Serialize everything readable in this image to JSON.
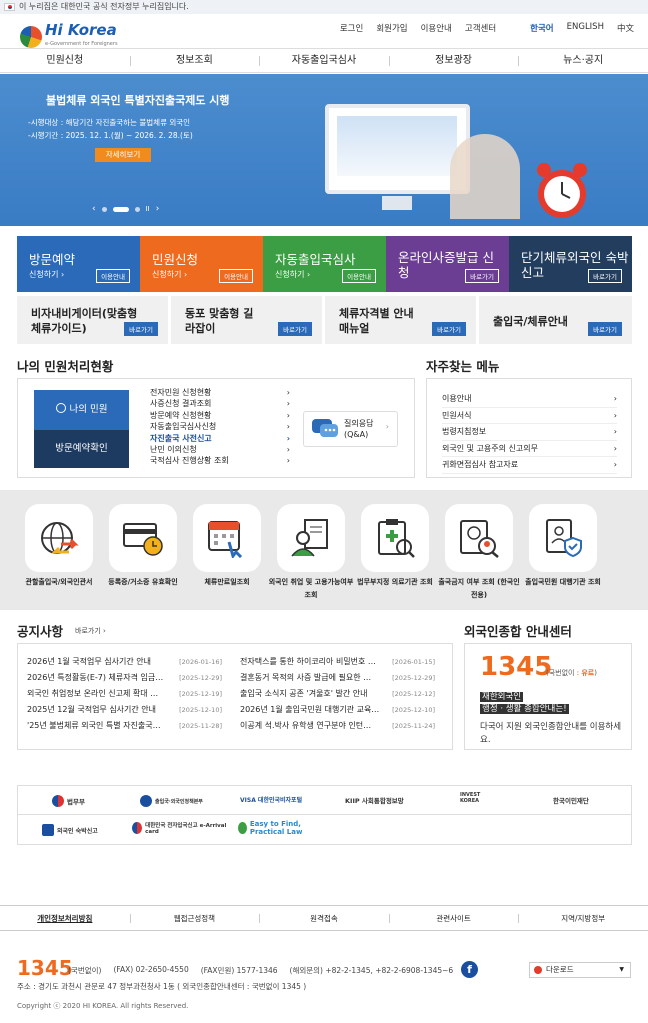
{
  "gov_bar": {
    "text": "이 누리집은 대한민국 공식 전자정부 누리집입니다."
  },
  "logo": {
    "name": "Hi Korea",
    "tagline": "e-Government for Foreigners"
  },
  "top_nav": [
    "로그인",
    "회원가입",
    "이용안내",
    "고객센터"
  ],
  "languages": [
    {
      "label": "한국어",
      "active": true
    },
    {
      "label": "ENGLISH",
      "active": false
    },
    {
      "label": "中文",
      "active": false
    }
  ],
  "main_menu": [
    "민원신청",
    "정보조회",
    "자동출입국심사",
    "정보광장",
    "뉴스·공지"
  ],
  "banner": {
    "title": "불법체류 외국인 특별자진출국제도 시행",
    "line1": "-시행대상 : 해당기간 자진출국하는 불법체류 외국인",
    "line2": "-시행기간 : 2025. 12. 1.(월) ~ 2026. 2. 28.(토)",
    "button": "자세히보기",
    "slide_controls": {
      "prev": "‹",
      "next": "›",
      "pause": "II"
    }
  },
  "service_tiles": [
    {
      "title": "방문예약",
      "sub": "신청하기 ›",
      "button": "이용안내",
      "color": "#2a6ab8"
    },
    {
      "title": "민원신청",
      "sub": "신청하기 ›",
      "button": "이용안내",
      "color": "#ee6a1f"
    },
    {
      "title": "자동출입국심사",
      "sub": "신청하기 ›",
      "button": "이용안내",
      "color": "#3b9d44"
    },
    {
      "title": "온라인사증발급 신청",
      "sub": "",
      "button": "바로가기",
      "color": "#6b3d93"
    },
    {
      "title": "단기체류외국인 숙박신고",
      "sub": "",
      "button": "바로가기",
      "color": "#223d5e"
    }
  ],
  "guide_tiles": [
    {
      "title": "비자내비게이터(맞춤형 체류가이드)",
      "button": "바로가기"
    },
    {
      "title": "동포 맞춤형 길라잡이",
      "button": "바로가기"
    },
    {
      "title": "체류자격별 안내매뉴얼",
      "button": "바로가기"
    },
    {
      "title": "출입국/체류안내",
      "button": "바로가기"
    }
  ],
  "my_status": {
    "heading": "나의 민원처리현황",
    "my_civil": "나의 민원",
    "visit_check": "방문예약확인",
    "items": [
      "전자민원 신청현황",
      "사증신청 결과조회",
      "방문예약 신청현황",
      "자동출입국심사신청",
      "자진출국 사전신고",
      "난민 이의신청",
      "국적심사 진행상황 조회"
    ],
    "highlight_index": 4,
    "qna": {
      "line1": "질의응답",
      "line2": "(Q&A)"
    }
  },
  "favorites": {
    "heading": "자주찾는 메뉴",
    "items": [
      "이용안내",
      "민원서식",
      "법령지침정보",
      "외국인 및 고용주의 신고의무",
      "귀화면접심사 참고자료"
    ]
  },
  "quick_icons": [
    {
      "label": "관할출입국/외국인관서",
      "icon": "globe-arrows-icon"
    },
    {
      "label": "등록증/거소증 유효확인",
      "icon": "id-card-clock-icon"
    },
    {
      "label": "체류만료일조회",
      "icon": "calendar-click-icon"
    },
    {
      "label": "외국인 취업 및 고용가능여부 조회",
      "icon": "worker-document-icon"
    },
    {
      "label": "법무부지정 의료기관 조회",
      "icon": "medical-clipboard-icon"
    },
    {
      "label": "출국금지 여부 조회 (한국인 전용)",
      "icon": "passport-search-icon"
    },
    {
      "label": "출입국민원 대행기관 조회",
      "icon": "agency-shield-icon"
    }
  ],
  "notices": {
    "heading": "공지사항",
    "more": "바로가기 ›",
    "left": [
      {
        "title": "2026년 1월 국적업무 심사기간 안내",
        "date": "[2026-01-16]"
      },
      {
        "title": "2026년 특정활동(E-7) 체류자격 임금…",
        "date": "[2025-12-29]"
      },
      {
        "title": "외국인 취업정보 온라인 신고제 확대 …",
        "date": "[2025-12-19]"
      },
      {
        "title": "2025년 12월 국적업무 심사기간 안내",
        "date": "[2025-12-10]"
      },
      {
        "title": "'25년 불법체류 외국인 특별 자진출국…",
        "date": "[2025-11-28]"
      }
    ],
    "right": [
      {
        "title": "전자택스를 통한 하이코리아 비밀번호 …",
        "date": "[2026-01-15]"
      },
      {
        "title": "결혼동거 목적의 사증 발급에 필요한 …",
        "date": "[2025-12-29]"
      },
      {
        "title": "출입국 소식지 공존 '겨울호' 발간 안내",
        "date": "[2025-12-12]"
      },
      {
        "title": "2026년 1월 출입국민원 대행기관 교육…",
        "date": "[2025-12-10]"
      },
      {
        "title": "이공계 석.박사 유학생 연구분야 인턴…",
        "date": "[2025-11-24]"
      }
    ]
  },
  "contact_center": {
    "heading": "외국인종합 안내센터",
    "number": "1345",
    "note_prefix": "(국번없이 : ",
    "note_paid": "유료",
    "note_suffix": ")",
    "hl1": "재한외국인",
    "hl2": "행정 · 생활 종합안내는!",
    "desc": "다국어 지원 외국인종합안내를 이용하세요."
  },
  "partners_row1": [
    "법무부",
    "출입국·외국인정책본부",
    "VISA 대한민국비자포털",
    "KIIP 사회통합정보망",
    "INVEST KOREA",
    "한국이민재단"
  ],
  "partners_row2": [
    "외국인 숙박신고",
    "대한민국 전자입국신고 e-Arrival card",
    "Easy to Find, Practical Law"
  ],
  "footer_nav": [
    "개인정보처리방침",
    "웹접근성정책",
    "원격접속",
    "관련사이트",
    "지역/지방정부"
  ],
  "footer": {
    "number": "1345",
    "number_note": "(국번없이)",
    "fax1": "(FAX) 02-2650-4550",
    "fax2": "(FAX민원) 1577-1346",
    "overseas": "(해외문의) +82-2-1345, +82-2-6908-1345~6",
    "address": "주소 : 경기도 과천시 관문로 47 정부과천청사 1동 ( 외국인종합안내센터 : 국번없이 1345 )",
    "copyright": "Copyright ⓒ 2020 HI KOREA. All rights Reserved.",
    "download": "다운로드"
  },
  "colors": {
    "primary": "#2a6ab8",
    "orange": "#ee6a1f",
    "green": "#3b9d44",
    "purple": "#6b3d93",
    "navy": "#223d5e"
  }
}
